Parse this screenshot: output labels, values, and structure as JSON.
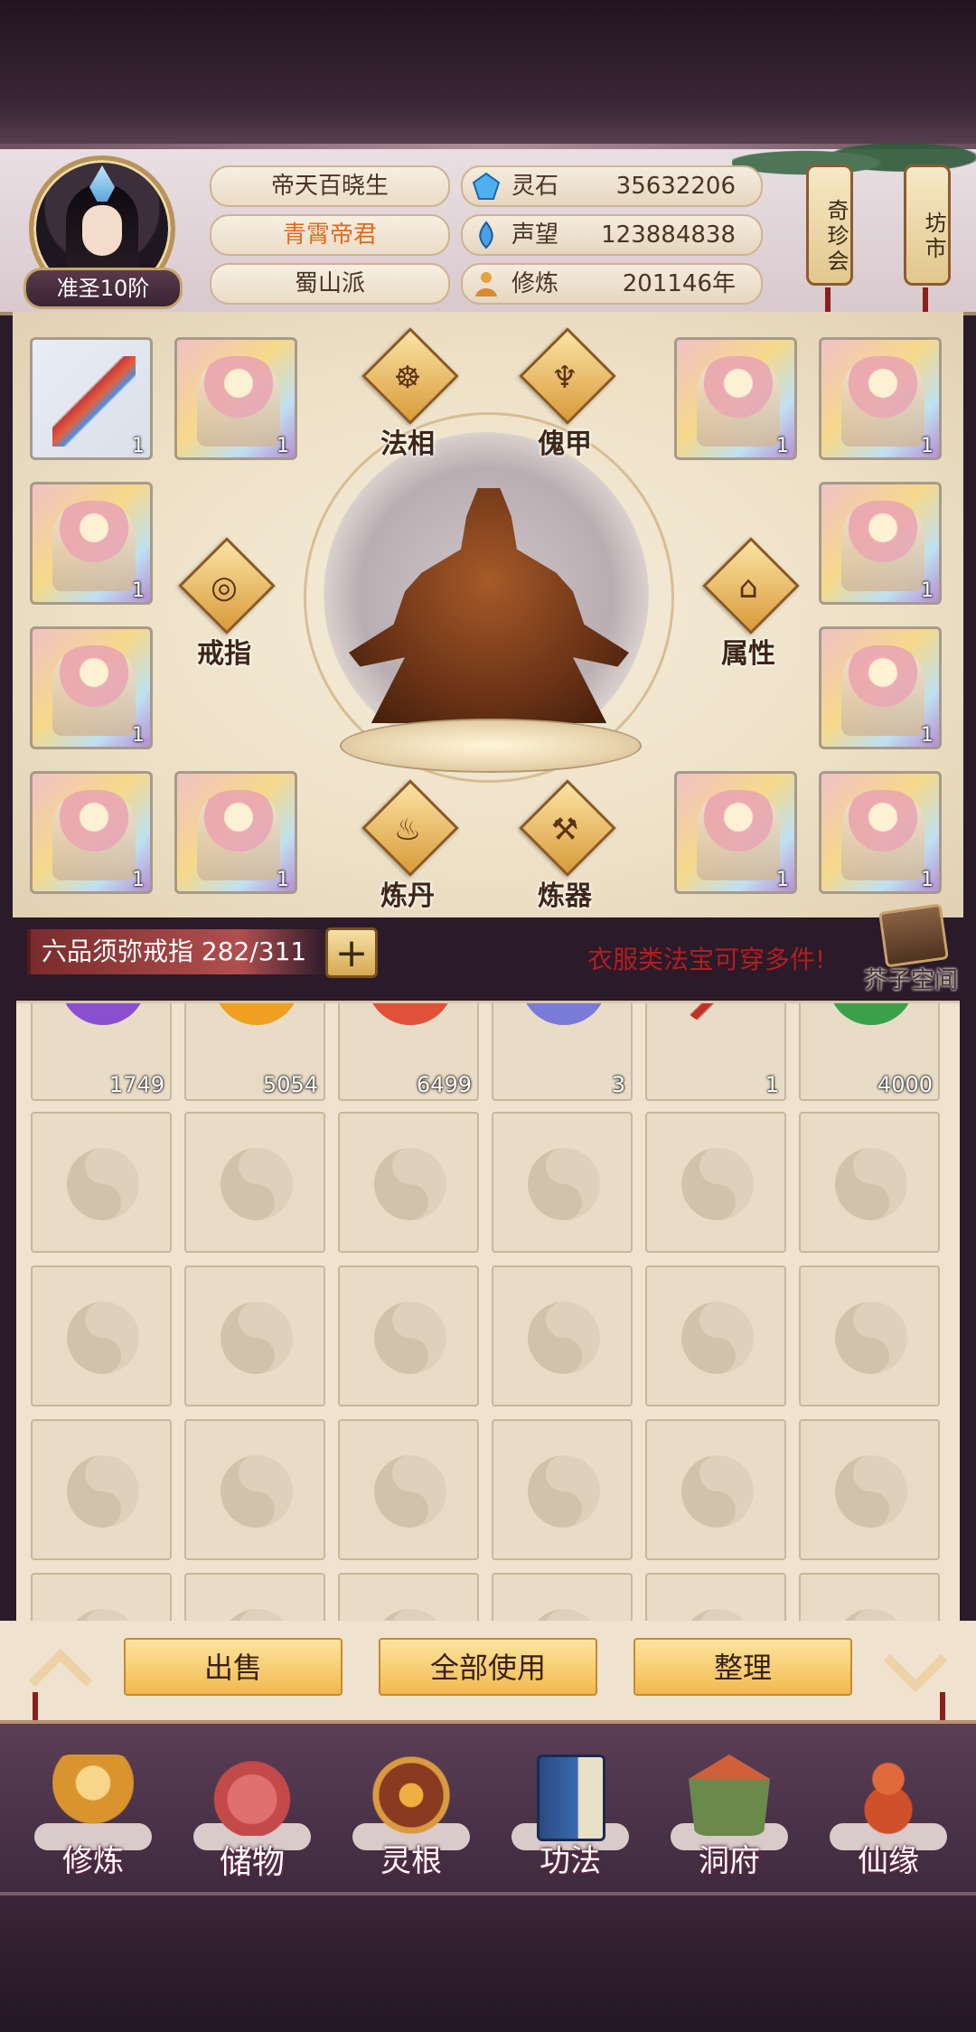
{
  "player": {
    "name": "帝天百晓生",
    "title": "青霄帝君",
    "sect": "蜀山派",
    "realm": "准圣10阶"
  },
  "resources": [
    {
      "label": "灵石",
      "value": "35632206",
      "icon": "spirit-stone-icon"
    },
    {
      "label": "声望",
      "value": "123884838",
      "icon": "reputation-icon"
    },
    {
      "label": "修炼",
      "value": "201146年",
      "icon": "cultivation-icon"
    }
  ],
  "shortcuts": [
    {
      "label": "奇珍会"
    },
    {
      "label": "坊市"
    }
  ],
  "equip_slots": {
    "left": [
      {
        "count": "1",
        "kind": "bow"
      },
      {
        "count": "1",
        "kind": "robe"
      },
      {
        "count": "1",
        "kind": "robe"
      },
      {
        "count": "1",
        "kind": "robe"
      },
      {
        "count": "1",
        "kind": "robe"
      },
      {
        "count": "1",
        "kind": "robe"
      }
    ],
    "right": [
      {
        "count": "1",
        "kind": "robe"
      },
      {
        "count": "1",
        "kind": "robe"
      },
      {
        "count": "1",
        "kind": "robe"
      },
      {
        "count": "1",
        "kind": "robe"
      },
      {
        "count": "1",
        "kind": "robe"
      },
      {
        "count": "1",
        "kind": "robe"
      }
    ]
  },
  "equip_buttons": {
    "faxiang": "法相",
    "kuijia": "傀甲",
    "jiezhi": "戒指",
    "shuxing": "属性",
    "liandan": "炼丹",
    "lianqi": "炼器"
  },
  "bag": {
    "name": "六品须弥戒指 282/311",
    "tip": "衣服类法宝可穿多件!",
    "space_label": "芥子空间"
  },
  "inventory": [
    {
      "qty": "1749",
      "color": "#8a4fd0"
    },
    {
      "qty": "5054",
      "color": "#f0a020"
    },
    {
      "qty": "6499",
      "color": "#e0503a"
    },
    {
      "qty": "3",
      "color": "#7a7ad8"
    },
    {
      "qty": "1",
      "color": "#c0302a"
    },
    {
      "qty": "4000",
      "color": "#3aa04a"
    }
  ],
  "actions": {
    "sell": "出售",
    "use_all": "全部使用",
    "sort": "整理"
  },
  "nav": [
    {
      "label": "修炼",
      "icon": "cultivate-icon",
      "color": "#d9942e"
    },
    {
      "label": "储物",
      "icon": "storage-bag-icon",
      "color": "#c44a4a"
    },
    {
      "label": "灵根",
      "icon": "spirit-root-icon",
      "color": "#8a3a20"
    },
    {
      "label": "功法",
      "icon": "technique-book-icon",
      "color": "#3a6ab0"
    },
    {
      "label": "洞府",
      "icon": "cave-dwelling-icon",
      "color": "#6a8a4a"
    },
    {
      "label": "仙缘",
      "icon": "destiny-gourd-icon",
      "color": "#d0502a"
    }
  ],
  "active_nav": "储物"
}
